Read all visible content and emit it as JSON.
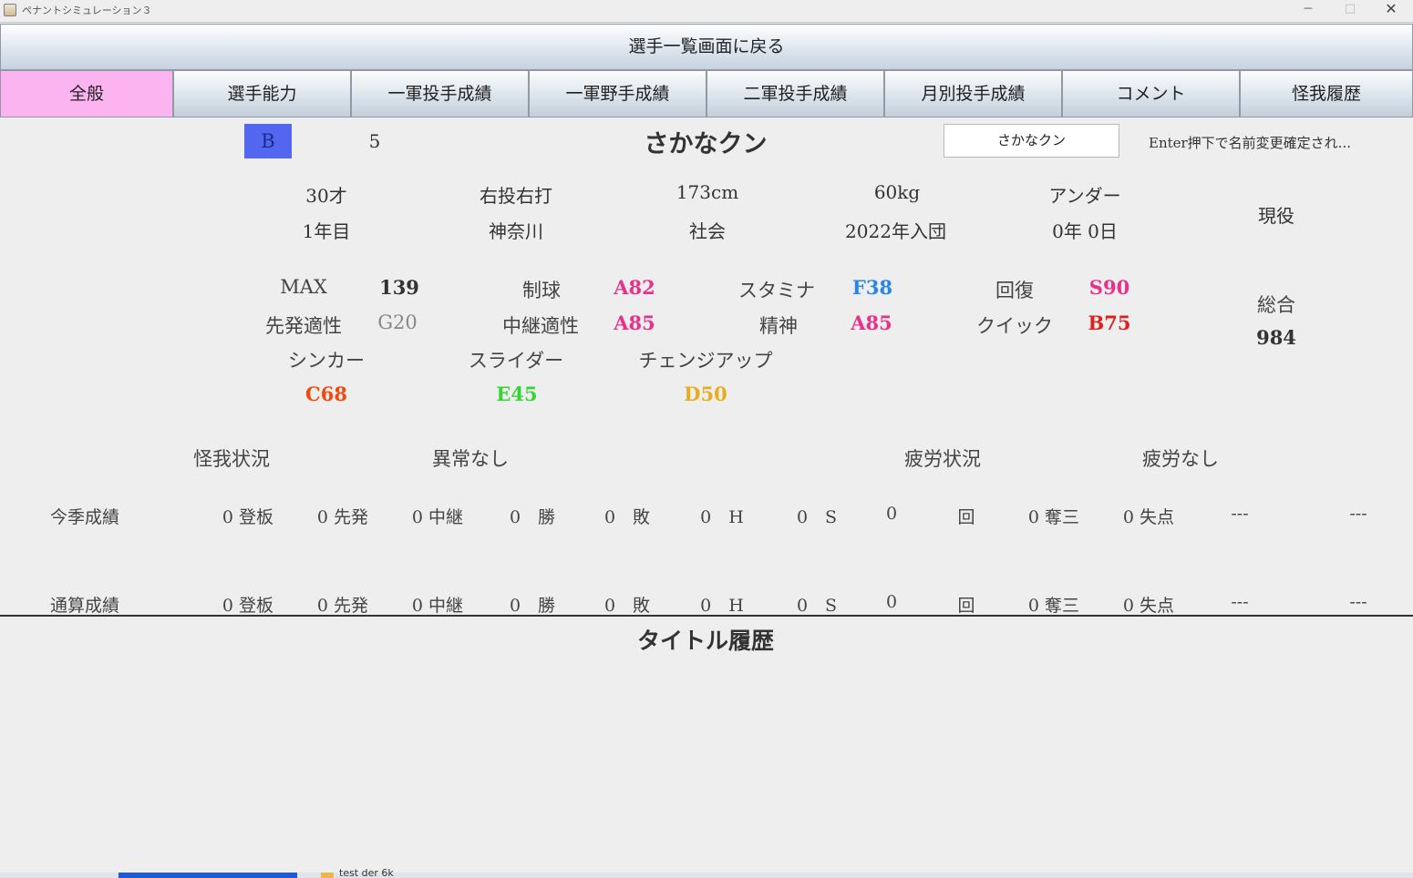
{
  "window": {
    "title": "ペナントシミュレーション３",
    "min": "─",
    "max": "□",
    "close": "✕"
  },
  "back_button": "選手一覧画面に戻る",
  "tabs": [
    "全般",
    "選手能力",
    "一軍投手成績",
    "一軍野手成績",
    "二軍投手成績",
    "月別投手成績",
    "コメント",
    "怪我履歴"
  ],
  "player": {
    "grade": "B",
    "number": "5",
    "name": "さかなクン",
    "name_input_value": "さかなクン",
    "name_hint": "Enter押下で名前変更確定され...",
    "age": "30才",
    "hand": "右投右打",
    "height": "173cm",
    "weight": "60kg",
    "type": "アンダー",
    "years": "1年目",
    "hometown": "神奈川",
    "origin": "社会",
    "joined": "2022年入団",
    "service": "0年 0日",
    "status": "現役"
  },
  "ability": {
    "max_label": "MAX",
    "max_value": "139",
    "control_label": "制球",
    "control_value": "A82",
    "stamina_label": "スタミナ",
    "stamina_value": "F38",
    "recovery_label": "回復",
    "recovery_value": "S90",
    "starter_label": "先発適性",
    "starter_value": "G20",
    "relief_label": "中継適性",
    "relief_value": "A85",
    "mental_label": "精神",
    "mental_value": "A85",
    "quick_label": "クイック",
    "quick_value": "B75",
    "total_label": "総合",
    "total_value": "984",
    "pitches": [
      {
        "name": "シンカー",
        "value": "C68",
        "color": "#f04a10"
      },
      {
        "name": "スライダー",
        "value": "E45",
        "color": "#34d534"
      },
      {
        "name": "チェンジアップ",
        "value": "D50",
        "color": "#e6ad1e"
      }
    ],
    "colors": {
      "control": "#e8328a",
      "stamina": "#2a86e6",
      "recovery": "#e8328a",
      "starter": "#888888",
      "relief": "#e8328a",
      "mental": "#e8328a",
      "quick": "#e0201e"
    }
  },
  "condition": {
    "injury_label": "怪我状況",
    "injury_value": "異常なし",
    "fatigue_label": "疲労状況",
    "fatigue_value": "疲労なし"
  },
  "season_stats": {
    "label": "今季成績",
    "cells": [
      "0 登板",
      "0 先発",
      "0 中継",
      "0　勝",
      "0　敗",
      "0　H",
      "0　S",
      "0",
      "回",
      "0 奪三",
      "0 失点",
      "---",
      "---"
    ]
  },
  "career_stats": {
    "label": "通算成績",
    "cells": [
      "0 登板",
      "0 先発",
      "0 中継",
      "0　勝",
      "0　敗",
      "0　H",
      "0　S",
      "0",
      "回",
      "0 奪三",
      "0 失点",
      "---",
      "---"
    ]
  },
  "title_history_heading": "タイトル履歴",
  "taskbar": {
    "item": "test der 6k"
  }
}
